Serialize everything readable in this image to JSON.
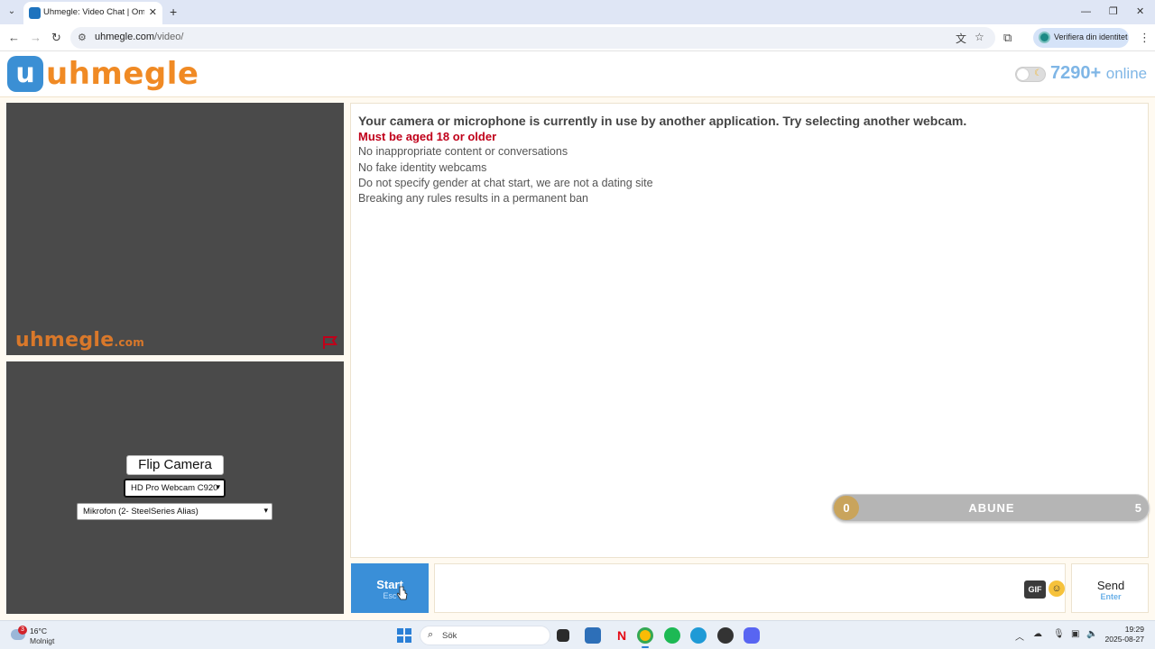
{
  "browser": {
    "tab_title": "Uhmegle: Video Chat | Omegle",
    "url_host": "uhmegle.com",
    "url_path": "/video/",
    "profile_label": "Verifiera din identitet"
  },
  "header": {
    "logo_text": "uhmegle",
    "online_count": "7290+",
    "online_label": "online"
  },
  "video": {
    "watermark_main": "uhmegle",
    "watermark_suffix": ".com",
    "flip_label": "Flip Camera",
    "camera_select": "HD Pro Webcam C920",
    "mic_select": "Mikrofon (2- SteelSeries Alias)"
  },
  "chat": {
    "warning": "Your camera or microphone is currently in use by another application. Try selecting another webcam.",
    "age_rule": "Must be aged 18 or older",
    "rules": [
      "No inappropriate content or conversations",
      "No fake identity webcams",
      "Do not specify gender at chat start, we are not a dating site",
      "Breaking any rules results in a permanent ban"
    ]
  },
  "abune": {
    "left_value": "0",
    "label": "ABUNE",
    "right_value": "5"
  },
  "controls": {
    "start_label": "Start",
    "start_shortcut": "Esc",
    "gif_label": "GIF",
    "send_label": "Send",
    "send_shortcut": "Enter"
  },
  "taskbar": {
    "weather_badge": "3",
    "temperature": "16°C",
    "weather_desc": "Molnigt",
    "search_placeholder": "Sök",
    "time": "19:29",
    "date": "2025-08-27"
  },
  "colors": {
    "accent_blue": "#3a8fd8",
    "logo_orange": "#f08a24",
    "age_red": "#c0001a",
    "video_bg": "#4a4a4a"
  }
}
